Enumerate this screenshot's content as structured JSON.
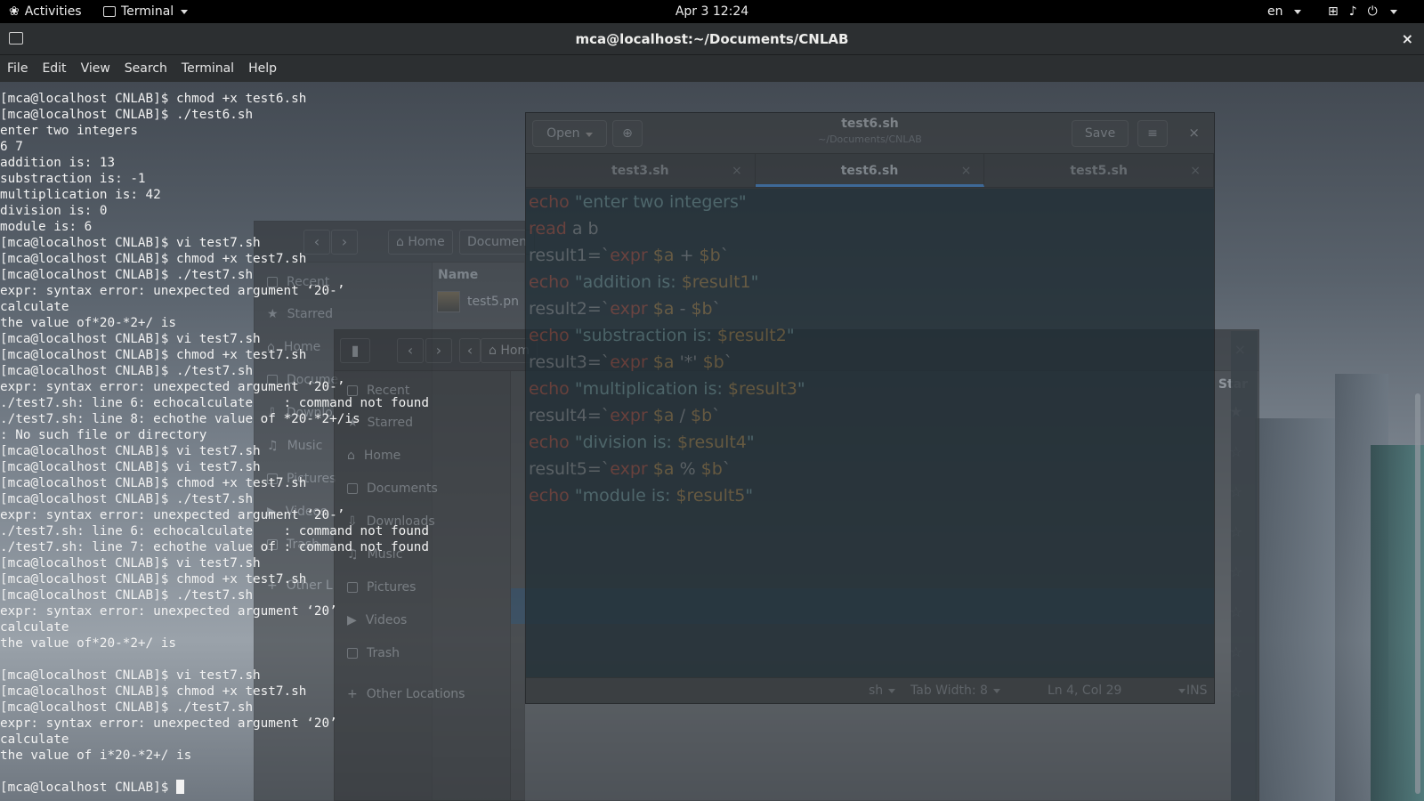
{
  "topbar": {
    "activities": "Activities",
    "app_name": "Terminal",
    "clock": "Apr 3  12:24",
    "language": "en"
  },
  "terminal": {
    "title": "mca@localhost:~/Documents/CNLAB",
    "menu": [
      "File",
      "Edit",
      "View",
      "Search",
      "Terminal",
      "Help"
    ],
    "lines": [
      "[mca@localhost CNLAB]$ chmod +x test6.sh",
      "[mca@localhost CNLAB]$ ./test6.sh",
      "enter two integers",
      "6 7",
      "addition is: 13",
      "substraction is: -1",
      "multiplication is: 42",
      "division is: 0",
      "module is: 6",
      "[mca@localhost CNLAB]$ vi test7.sh",
      "[mca@localhost CNLAB]$ chmod +x test7.sh",
      "[mca@localhost CNLAB]$ ./test7.sh",
      "expr: syntax error: unexpected argument ‘20-’",
      "calculate",
      "the value of*20-*2+/ is",
      "[mca@localhost CNLAB]$ vi test7.sh",
      "[mca@localhost CNLAB]$ chmod +x test7.sh",
      "[mca@localhost CNLAB]$ ./test7.sh",
      "expr: syntax error: unexpected argument ‘20-’",
      "./test7.sh: line 6: echocalculate    : command not found",
      "./test7.sh: line 8: echothe value of *20-*2+/is",
      ": No such file or directory",
      "[mca@localhost CNLAB]$ vi test7.sh",
      "[mca@localhost CNLAB]$ vi test7.sh",
      "[mca@localhost CNLAB]$ chmod +x test7.sh",
      "[mca@localhost CNLAB]$ ./test7.sh",
      "expr: syntax error: unexpected argument ‘20-’",
      "./test7.sh: line 6: echocalculate    : command not found",
      "./test7.sh: line 7: echothe value of : command not found",
      "[mca@localhost CNLAB]$ vi test7.sh",
      "[mca@localhost CNLAB]$ chmod +x test7.sh",
      "[mca@localhost CNLAB]$ ./test7.sh",
      "expr: syntax error: unexpected argument ‘20’",
      "calculate",
      "the value of*20-*2+/ is",
      "",
      "[mca@localhost CNLAB]$ vi test7.sh",
      "[mca@localhost CNLAB]$ chmod +x test7.sh",
      "[mca@localhost CNLAB]$ ./test7.sh",
      "expr: syntax error: unexpected argument ‘20’",
      "calculate",
      "the value of i*20-*2+/ is",
      ""
    ],
    "prompt": "[mca@localhost CNLAB]$ "
  },
  "gedit": {
    "open_label": "Open",
    "save_label": "Save",
    "title": "test6.sh",
    "subtitle": "~/Documents/CNLAB",
    "tabs": [
      "test3.sh",
      "test6.sh",
      "test5.sh"
    ],
    "code": [
      [
        {
          "t": "echo",
          "c": "kw"
        },
        {
          "t": " \"enter two integers\"",
          "c": "str"
        }
      ],
      [
        {
          "t": "read",
          "c": "kw"
        },
        {
          "t": " a b",
          "c": "plain"
        }
      ],
      [
        {
          "t": "result1",
          "c": "plain"
        },
        {
          "t": "=`",
          "c": "plain"
        },
        {
          "t": "expr",
          "c": "kw"
        },
        {
          "t": " $a",
          "c": "var"
        },
        {
          "t": " + ",
          "c": "plain"
        },
        {
          "t": "$b",
          "c": "var"
        },
        {
          "t": "`",
          "c": "plain"
        }
      ],
      [
        {
          "t": "echo",
          "c": "kw"
        },
        {
          "t": " \"addition is: ",
          "c": "str"
        },
        {
          "t": "$result1",
          "c": "var"
        },
        {
          "t": "\"",
          "c": "str"
        }
      ],
      [
        {
          "t": "result2",
          "c": "plain"
        },
        {
          "t": "=`",
          "c": "plain"
        },
        {
          "t": "expr",
          "c": "kw"
        },
        {
          "t": " $a",
          "c": "var"
        },
        {
          "t": " - ",
          "c": "plain"
        },
        {
          "t": "$b",
          "c": "var"
        },
        {
          "t": "`",
          "c": "plain"
        }
      ],
      [
        {
          "t": "echo",
          "c": "kw"
        },
        {
          "t": " \"substraction is: ",
          "c": "str"
        },
        {
          "t": "$result2",
          "c": "var"
        },
        {
          "t": "\"",
          "c": "str"
        }
      ],
      [
        {
          "t": "result3",
          "c": "plain"
        },
        {
          "t": "=`",
          "c": "plain"
        },
        {
          "t": "expr",
          "c": "kw"
        },
        {
          "t": " $a",
          "c": "var"
        },
        {
          "t": " '*' ",
          "c": "plain"
        },
        {
          "t": "$b",
          "c": "var"
        },
        {
          "t": "`",
          "c": "plain"
        }
      ],
      [
        {
          "t": "echo",
          "c": "kw"
        },
        {
          "t": " \"multiplication is: ",
          "c": "str"
        },
        {
          "t": "$result3",
          "c": "var"
        },
        {
          "t": "\"",
          "c": "str"
        }
      ],
      [
        {
          "t": "result4",
          "c": "plain"
        },
        {
          "t": "=`",
          "c": "plain"
        },
        {
          "t": "expr",
          "c": "kw"
        },
        {
          "t": " $a",
          "c": "var"
        },
        {
          "t": " / ",
          "c": "plain"
        },
        {
          "t": "$b",
          "c": "var"
        },
        {
          "t": "`",
          "c": "plain"
        }
      ],
      [
        {
          "t": "echo",
          "c": "kw"
        },
        {
          "t": " \"division is: ",
          "c": "str"
        },
        {
          "t": "$result4",
          "c": "var"
        },
        {
          "t": "\"",
          "c": "str"
        }
      ],
      [
        {
          "t": "result5",
          "c": "plain"
        },
        {
          "t": "=`",
          "c": "plain"
        },
        {
          "t": "expr",
          "c": "kw"
        },
        {
          "t": " $a",
          "c": "var"
        },
        {
          "t": " % ",
          "c": "plain"
        },
        {
          "t": "$b",
          "c": "var"
        },
        {
          "t": "`",
          "c": "plain"
        }
      ],
      [
        {
          "t": "echo",
          "c": "kw"
        },
        {
          "t": " \"module is: ",
          "c": "str"
        },
        {
          "t": "$result5",
          "c": "var"
        },
        {
          "t": "\"",
          "c": "str"
        }
      ]
    ],
    "status": {
      "language": "sh",
      "tab_width": "Tab Width: 8",
      "position": "Ln 4, Col 29",
      "mode": "INS"
    }
  },
  "file_manager_back": {
    "home": "Home",
    "documents": "Documen",
    "column_name": "Name",
    "file": "test5.pn",
    "sidebar": [
      "Recent",
      "Starred",
      "Home",
      "Docume",
      "Downlo",
      "Music",
      "Pictures",
      "Videos",
      "Trash",
      "Other L"
    ]
  },
  "file_manager_front": {
    "home": "Hom",
    "column_star": "Star",
    "sidebar": [
      "Recent",
      "Starred",
      "Home",
      "Documents",
      "Downloads",
      "Music",
      "Pictures",
      "Videos",
      "Trash",
      "Other Locations"
    ]
  }
}
